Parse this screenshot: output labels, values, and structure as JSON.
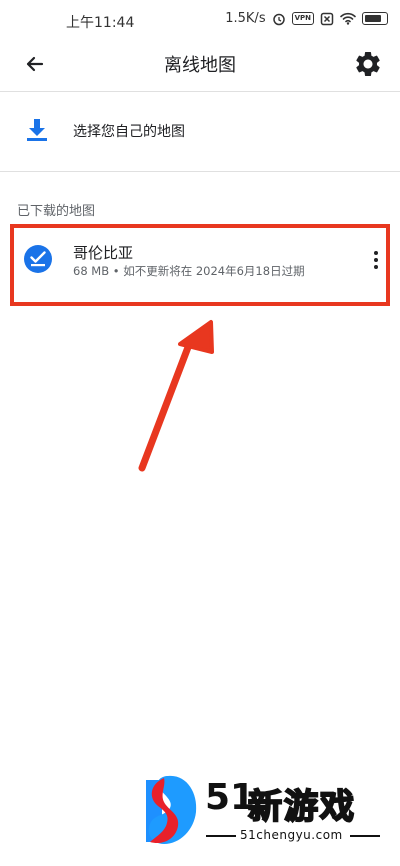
{
  "status_bar": {
    "time": "上午11:44",
    "net_speed": "1.5K/s",
    "vpn_badge": "VPN",
    "battery_icon": "battery-icon"
  },
  "app_bar": {
    "title": "离线地图",
    "back_icon": "arrow-left-icon",
    "settings_icon": "gear-icon"
  },
  "select_own_map": {
    "label": "选择您自己的地图",
    "icon": "download-icon"
  },
  "downloaded_section": {
    "header": "已下载的地图",
    "items": [
      {
        "name": "哥伦比亚",
        "meta": "68 MB • 如不更新将在 2024年6月18日过期",
        "status_icon": "check-circle-icon",
        "menu_icon": "more-vert-icon"
      }
    ]
  },
  "watermark": {
    "number": "51",
    "text": "新游戏",
    "url": "51chengyu.com"
  },
  "colors": {
    "accent_blue": "#1a73e8",
    "annotation_red": "#e8371f"
  }
}
